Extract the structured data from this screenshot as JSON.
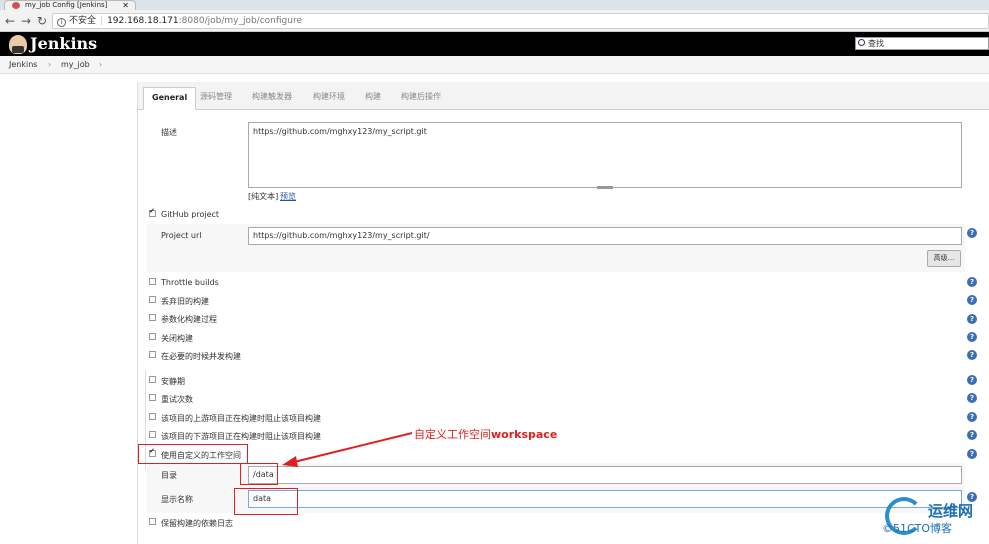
{
  "browser": {
    "tab_title": "my_job Config [Jenkins]",
    "tab_close": "✕",
    "security_label": "不安全",
    "url_host": "192.168.18.171",
    "url_path": ":8080/job/my_job/configure"
  },
  "header": {
    "title": "Jenkins",
    "search_placeholder": "查找"
  },
  "breadcrumbs": {
    "items": [
      "Jenkins",
      "my_job"
    ],
    "sep": "›"
  },
  "tabs": [
    {
      "label": "General"
    },
    {
      "label": "源码管理"
    },
    {
      "label": "构建触发器"
    },
    {
      "label": "构建环境"
    },
    {
      "label": "构建"
    },
    {
      "label": "构建后操作"
    }
  ],
  "general": {
    "description_label": "描述",
    "description_value": "https://github.com/mghxy123/my_script.git",
    "plain_text": "[纯文本]",
    "preview": "预览",
    "github_project": "GitHub project",
    "project_url_label": "Project url",
    "project_url_value": "https://github.com/mghxy123/my_script.git/",
    "advanced_button": "高级...",
    "options": [
      {
        "label": "Throttle builds",
        "checked": false
      },
      {
        "label": "丢弃旧的构建",
        "checked": false
      },
      {
        "label": "参数化构建过程",
        "checked": false
      },
      {
        "label": "关闭构建",
        "checked": false
      },
      {
        "label": "在必要的时候并发构建",
        "checked": false
      },
      {
        "label": "安静期",
        "checked": false
      },
      {
        "label": "重试次数",
        "checked": false
      },
      {
        "label": "该项目的上游项目正在构建时阻止该项目构建",
        "checked": false
      },
      {
        "label": "该项目的下游项目正在构建时阻止该项目构建",
        "checked": false
      },
      {
        "label": "使用自定义的工作空间",
        "checked": true
      }
    ],
    "directory_label": "目录",
    "directory_value": "/data",
    "display_name_label": "显示名称",
    "display_name_value": "data",
    "keep_deps": "保留构建的依赖日志"
  },
  "annotation": {
    "text_cn": "自定义工作空间",
    "text_en": "workspace"
  },
  "watermark": {
    "line1": "运维网",
    "line2": "©51CTO博客"
  },
  "colors": {
    "annotation_red": "#e02020",
    "help_blue": "#3a6fb5"
  }
}
